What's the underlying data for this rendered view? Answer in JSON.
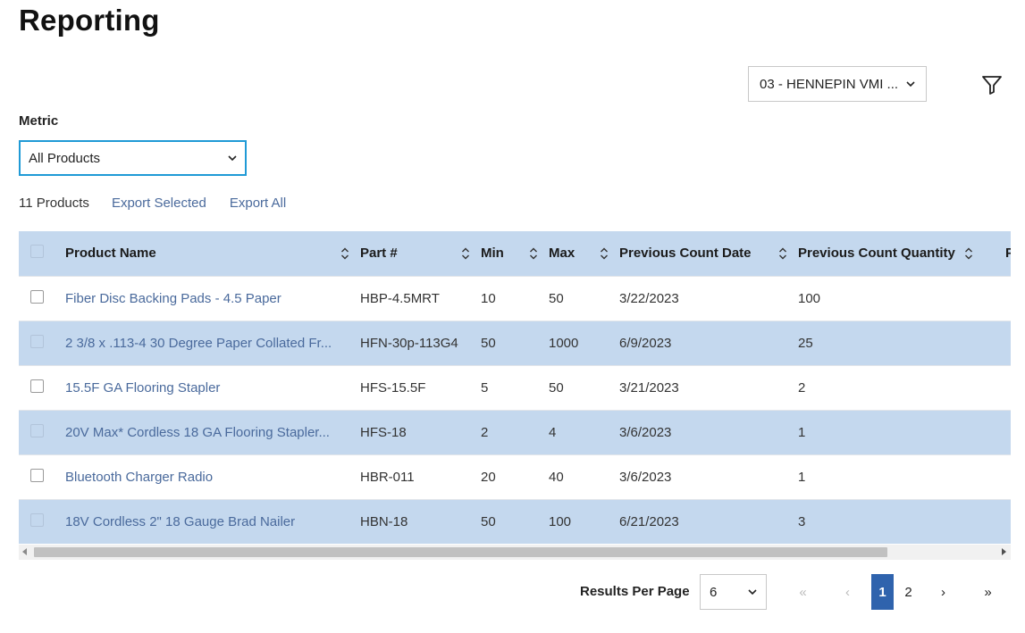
{
  "page": {
    "title": "Reporting"
  },
  "location_filter": {
    "value": "03 - HENNEPIN VMI ..."
  },
  "metric": {
    "label": "Metric",
    "value": "All Products"
  },
  "toolbar": {
    "count": "11 Products",
    "export_selected": "Export Selected",
    "export_all": "Export All"
  },
  "table": {
    "columns": [
      "Product Name",
      "Part #",
      "Min",
      "Max",
      "Previous Count Date",
      "Previous Count Quantity",
      "P"
    ],
    "rows": [
      {
        "name": "Fiber Disc Backing Pads - 4.5 Paper",
        "part": "HBP-4.5MRT",
        "min": "10",
        "max": "50",
        "date": "3/22/2023",
        "qty": "100"
      },
      {
        "name": "2 3/8 x .113-4 30 Degree Paper Collated Fr...",
        "part": "HFN-30p-113G4",
        "min": "50",
        "max": "1000",
        "date": "6/9/2023",
        "qty": "25"
      },
      {
        "name": "15.5F GA Flooring Stapler",
        "part": "HFS-15.5F",
        "min": "5",
        "max": "50",
        "date": "3/21/2023",
        "qty": "2"
      },
      {
        "name": "20V Max* Cordless 18 GA Flooring Stapler...",
        "part": "HFS-18",
        "min": "2",
        "max": "4",
        "date": "3/6/2023",
        "qty": "1"
      },
      {
        "name": "Bluetooth Charger Radio",
        "part": "HBR-011",
        "min": "20",
        "max": "40",
        "date": "3/6/2023",
        "qty": "1"
      },
      {
        "name": "18V Cordless 2\" 18 Gauge Brad Nailer",
        "part": "HBN-18",
        "min": "50",
        "max": "100",
        "date": "6/21/2023",
        "qty": "3"
      }
    ]
  },
  "pagination": {
    "rpp_label": "Results Per Page",
    "rpp_value": "6",
    "first": "«",
    "prev": "‹",
    "pages": [
      "1",
      "2"
    ],
    "next": "›",
    "last": "»"
  },
  "colors": {
    "header_bg": "#c4d8ee",
    "link": "#4a6a9c",
    "active_page": "#2f63ad",
    "focus": "#1f9ad6"
  },
  "icons": [
    "chevron-down-icon",
    "filter-icon",
    "sort-icon",
    "checkbox"
  ]
}
